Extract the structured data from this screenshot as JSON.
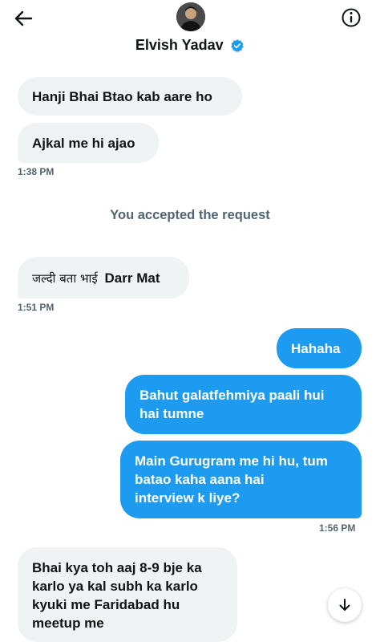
{
  "header": {
    "contact_name": "Elvish Yadav",
    "verified_color": "#1d9bf0",
    "icons": {
      "back": "arrow-left-icon",
      "info": "info-icon",
      "verified": "verified-badge-icon"
    }
  },
  "messages": [
    {
      "direction": "incoming",
      "text": "Hanji Bhai Btao kab aare ho"
    },
    {
      "direction": "incoming",
      "text": "Ajkal me hi ajao",
      "time": "1:38 PM"
    },
    {
      "direction": "system",
      "text": "You accepted the request"
    },
    {
      "direction": "incoming",
      "text_hindi": "जल्दी बता भाई",
      "text_bold": "Darr Mat",
      "time": "1:51 PM"
    },
    {
      "direction": "outgoing",
      "text": "Hahaha"
    },
    {
      "direction": "outgoing",
      "lines": [
        "Bahut galatfehmiya paali hui",
        "hai tumne"
      ]
    },
    {
      "direction": "outgoing",
      "lines": [
        "Main Gurugram me hi hu, tum",
        "batao kaha aana hai",
        "interview k liye?"
      ],
      "time": "1:56 PM"
    },
    {
      "direction": "incoming",
      "lines": [
        "Bhai kya toh aaj 8-9 bje ka",
        "karlo ya kal subh ka karlo",
        "kyuki me Faridabad hu",
        "meetup me"
      ]
    }
  ],
  "controls": {
    "scroll_down": "arrow-down-icon"
  },
  "colors": {
    "incoming_bubble": "#eff3f4",
    "outgoing_bubble": "#1d9bf0",
    "meta_text": "#536471"
  }
}
